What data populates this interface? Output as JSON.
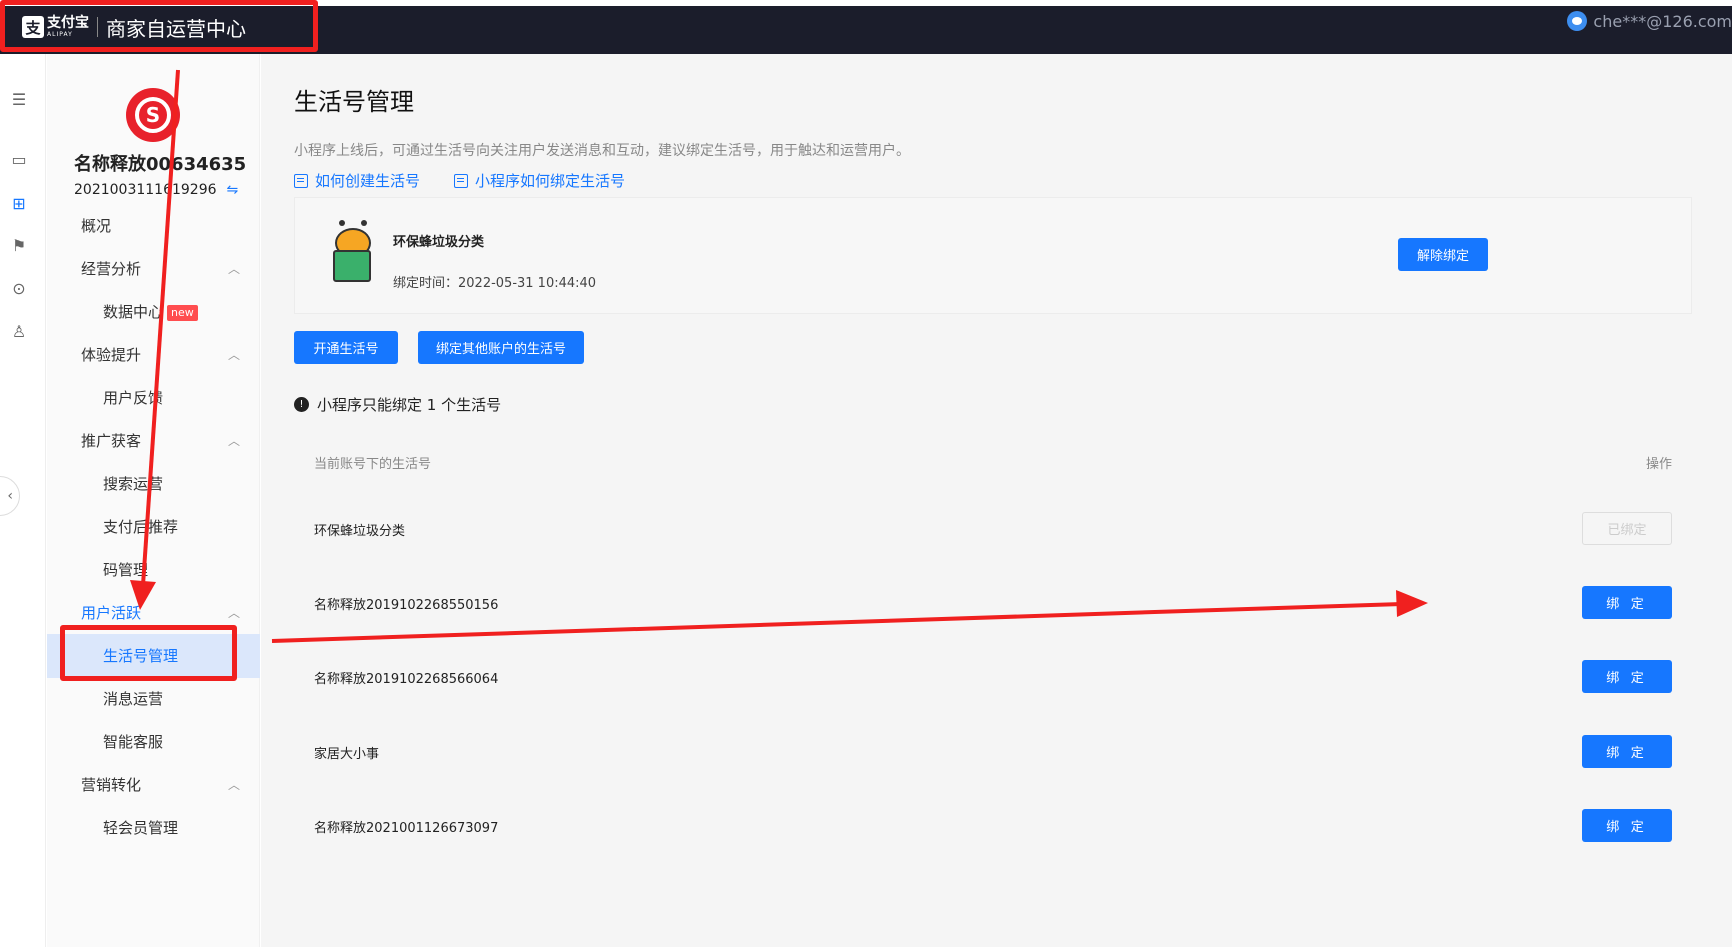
{
  "topbar": {
    "logo_cn": "支付宝",
    "logo_en": "ALIPAY",
    "title": "商家自运营中心",
    "user_email": "che***@126.com"
  },
  "rail": {
    "icons": [
      "menu-icon",
      "monitor-icon",
      "grid-icon",
      "flag-icon",
      "search-chart-icon",
      "basket-icon"
    ],
    "collapse_glyph": "‹"
  },
  "account": {
    "name": "名称释放00634635",
    "id": "2021003111619296"
  },
  "menu": {
    "overview": "概况",
    "business_analysis": "经营分析",
    "data_center": "数据中心",
    "new_badge": "new",
    "experience": "体验提升",
    "user_feedback": "用户反馈",
    "promotion": "推广获客",
    "search_ops": "搜索运营",
    "after_pay": "支付后推荐",
    "code_mgmt": "码管理",
    "user_active": "用户活跃",
    "life_account_mgmt": "生活号管理",
    "message_ops": "消息运营",
    "smart_service": "智能客服",
    "marketing": "营销转化",
    "light_member": "轻会员管理"
  },
  "main": {
    "title": "生活号管理",
    "description": "小程序上线后，可通过生活号向关注用户发送消息和互动，建议绑定生活号，用于触达和运营用户。",
    "help_link_1": "如何创建生活号",
    "help_link_2": "小程序如何绑定生活号",
    "bound": {
      "name": "环保蜂垃圾分类",
      "time": "绑定时间：2022-05-31 10:44:40",
      "unbind_label": "解除绑定"
    },
    "open_label": "开通生活号",
    "bind_other_label": "绑定其他账户的生活号",
    "notice": "小程序只能绑定 1 个生活号",
    "table": {
      "col_name": "当前账号下的生活号",
      "col_op": "操作",
      "rows": [
        {
          "name": "环保蜂垃圾分类",
          "action": "已绑定",
          "disabled": true
        },
        {
          "name": "名称释放2019102268550156",
          "action": "绑 定"
        },
        {
          "name": "名称释放2019102268566064",
          "action": "绑 定"
        },
        {
          "name": "家居大小事",
          "action": "绑 定"
        },
        {
          "name": "名称释放2021001126673097",
          "action": "绑 定"
        }
      ]
    }
  },
  "colors": {
    "primary": "#1677ff",
    "topbar": "#1b1d2b",
    "annotation_red": "#f0201f",
    "brand_red": "#e8212b"
  }
}
